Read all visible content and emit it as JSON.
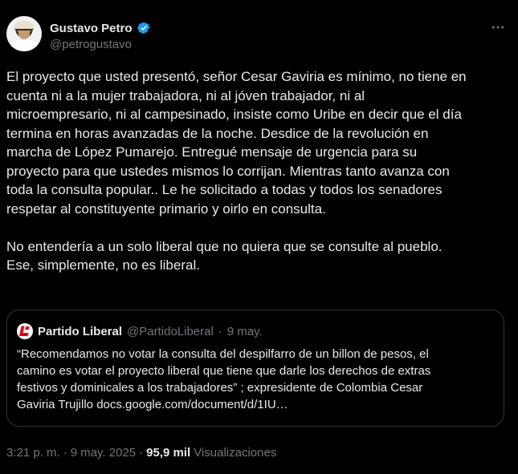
{
  "author": {
    "display_name": "Gustavo Petro",
    "handle": "@petrogustavo",
    "verified_icon": "verified-badge-icon",
    "badge_color": "#1d9bf0"
  },
  "more_icon": "more-options-icon",
  "tweet": {
    "paragraph_1": "El proyecto que usted presentó, señor Cesar Gaviria es mínimo, no tiene en\ncuenta ni a la mujer trabajadora, ni al jóven trabajador, ni al\nmicroempresario, ni al campesinado, insiste como Uribe en decir que el día\ntermina en horas avanzadas de la noche. Desdice de la revolución en\nmarcha de López Pumarejo. Entregué mensaje de urgencia para su\nproyecto para  que ustedes mismos lo corrijan. Mientras tanto avanza con\ntoda la consulta popular.. Le he solicitado a todas y todos los senadores\nrespetar al constituyente primario y oirlo en consulta.",
    "paragraph_2": "No entendería a un solo liberal que no quiera que se consulte al pueblo.\nEse, simplemente, no es liberal."
  },
  "quoted_tweet": {
    "logo_icon": "partido-liberal-logo-icon",
    "logo_color": "#e2001a",
    "display_name": "Partido Liberal",
    "handle": "@PartidoLiberal",
    "separator": "·",
    "date": "9 may.",
    "text": "“Recomendamos no votar la consulta del despilfarro de un billon de pesos, el\ncamino es votar el proyecto liberal que tiene que darle los derechos de extras\nfestivos y dominicales a los trabajadores” ; expresidente de Colombia Cesar\nGaviria Trujillo docs.google.com/document/d/1IU…"
  },
  "meta": {
    "time": "3:21 p. m.",
    "separator_1": "·",
    "date": "9 may. 2025",
    "separator_2": "·",
    "views_count": "95,9 mil",
    "views_label": "Visualizaciones"
  },
  "colors": {
    "background": "#000000",
    "primary_text": "#e7e9ea",
    "secondary_text": "#71767b",
    "border": "#2f3336"
  }
}
